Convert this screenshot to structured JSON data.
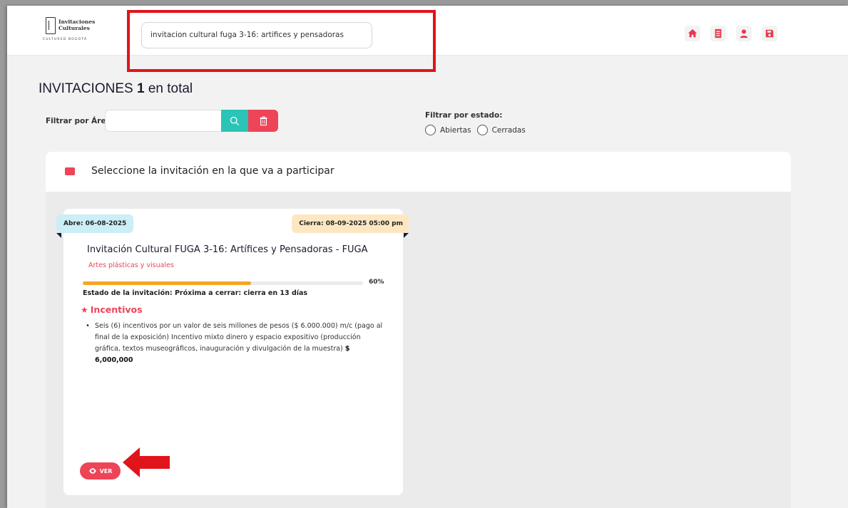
{
  "header": {
    "logo_line1": "Invitaciones",
    "logo_line2": "Culturales",
    "logo_sub": "CULTURED BOGOTÁ",
    "search_value": "invitacion cultural fuga 3-16: artifices y pensadoras",
    "icons": [
      "home-icon",
      "list-icon",
      "user-icon",
      "save-icon"
    ],
    "accent": "#e8384f",
    "highlight_color": "#e0141b"
  },
  "page": {
    "title_prefix": "INVITACIONES",
    "title_count": "1",
    "title_suffix": "en total"
  },
  "filters": {
    "area_label": "Filtrar por Área:",
    "area_value": "",
    "state_label": "Filtrar por estado:",
    "state_options": [
      "Abiertas",
      "Cerradas"
    ],
    "search_color": "#2bc4b6",
    "clear_color": "#ee4458"
  },
  "panel": {
    "heading": "Seleccione la invitación en la que va a participar"
  },
  "card": {
    "opens": "Abre: 06-08-2025",
    "closes": "Cierra: 08-09-2025 05:00 pm",
    "title": "Invitación Cultural FUGA 3-16: Artífices y Pensadoras - FUGA",
    "area": "Artes plásticas y visuales",
    "progress_percent": 60,
    "progress_label": "60%",
    "status": "Estado de la invitación: Próxima a cerrar: cierra en 13 días",
    "incentives_title": "Incentivos",
    "incentive_text": "Seis (6) incentivos por un valor de seis millones de pesos ($ 6.000.000) m/c (pago al final de la exposición) Incentivo mixto dinero y espacio expositivo (producción gráfica, textos museográficos, inauguración y divulgación de la muestra)",
    "incentive_amount": "$ 6,000,000",
    "view_label": "VER"
  }
}
